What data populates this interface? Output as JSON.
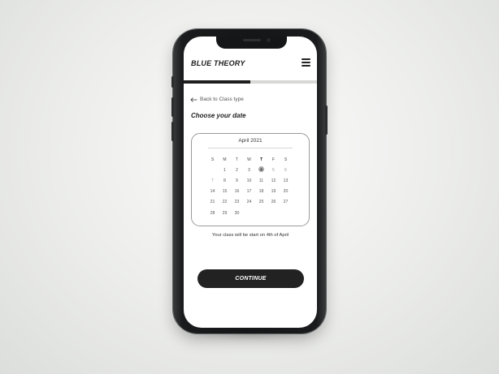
{
  "app": {
    "brand": "BLUE THEORY",
    "menu_icon": "hamburger-icon"
  },
  "progress": {
    "fraction": 0.5
  },
  "nav": {
    "back_label": "Back to Class type",
    "back_icon": "arrow-left-icon"
  },
  "page": {
    "title": "Choose your date"
  },
  "calendar": {
    "month": "April 2021",
    "weekdays": [
      "S",
      "M",
      "T",
      "W",
      "T",
      "F",
      "S"
    ],
    "weeks": [
      [
        "",
        "1",
        "2",
        "3",
        "4",
        "5",
        "6"
      ],
      [
        "7",
        "8",
        "9",
        "10",
        "11",
        "12",
        "13"
      ],
      [
        "14",
        "15",
        "16",
        "17",
        "18",
        "19",
        "20"
      ],
      [
        "21",
        "22",
        "23",
        "24",
        "25",
        "26",
        "27"
      ],
      [
        "28",
        "29",
        "30",
        "",
        "",
        "",
        ""
      ]
    ],
    "selected_day": "4"
  },
  "note": "Your class will be start on 4th of April",
  "actions": {
    "continue_label": "CONTINUE"
  },
  "colors": {
    "accent": "#222222",
    "selected_day_bg": "#a9a9a9",
    "progress_track": "#d8d8d6"
  }
}
